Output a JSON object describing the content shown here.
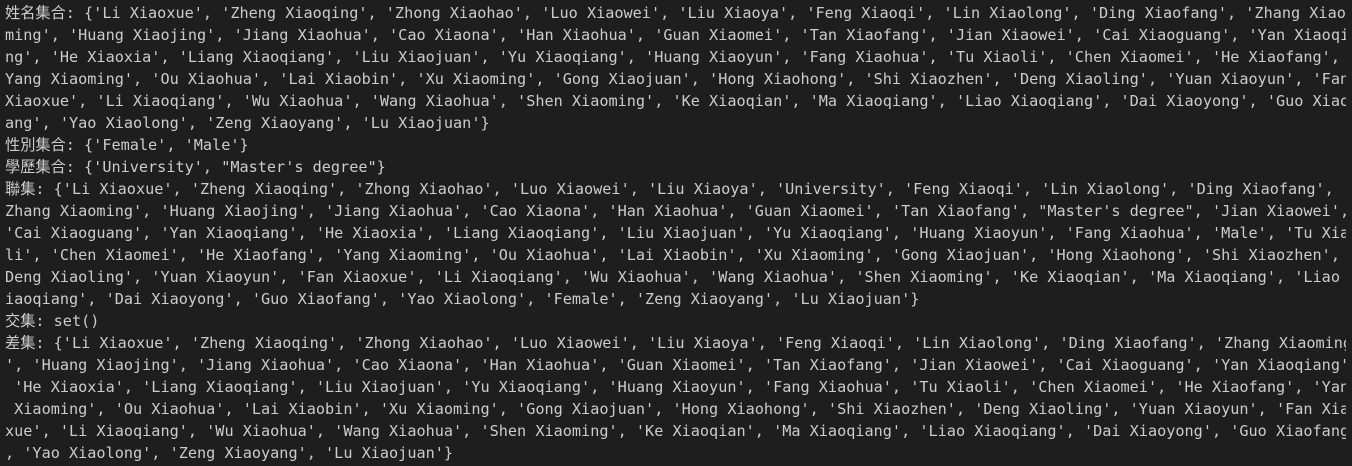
{
  "terminal": {
    "lines": [
      "姓名集合: {'Li Xiaoxue', 'Zheng Xiaoqing', 'Zhong Xiaohao', 'Luo Xiaowei', 'Liu Xiaoya', 'Feng Xiaoqi', 'Lin Xiaolong', 'Ding Xiaofang', 'Zhang Xiao",
      "ming', 'Huang Xiaojing', 'Jiang Xiaohua', 'Cao Xiaona', 'Han Xiaohua', 'Guan Xiaomei', 'Tan Xiaofang', 'Jian Xiaowei', 'Cai Xiaoguang', 'Yan Xiaoqia",
      "ng', 'He Xiaoxia', 'Liang Xiaoqiang', 'Liu Xiaojuan', 'Yu Xiaoqiang', 'Huang Xiaoyun', 'Fang Xiaohua', 'Tu Xiaoli', 'Chen Xiaomei', 'He Xiaofang', '",
      "Yang Xiaoming', 'Ou Xiaohua', 'Lai Xiaobin', 'Xu Xiaoming', 'Gong Xiaojuan', 'Hong Xiaohong', 'Shi Xiaozhen', 'Deng Xiaoling', 'Yuan Xiaoyun', 'Fan",
      "Xiaoxue', 'Li Xiaoqiang', 'Wu Xiaohua', 'Wang Xiaohua', 'Shen Xiaoming', 'Ke Xiaoqian', 'Ma Xiaoqiang', 'Liao Xiaoqiang', 'Dai Xiaoyong', 'Guo Xiaof",
      "ang', 'Yao Xiaolong', 'Zeng Xiaoyang', 'Lu Xiaojuan'}",
      "性別集合: {'Female', 'Male'}",
      "學歷集合: {'University', \"Master's degree\"}",
      "聯集: {'Li Xiaoxue', 'Zheng Xiaoqing', 'Zhong Xiaohao', 'Luo Xiaowei', 'Liu Xiaoya', 'University', 'Feng Xiaoqi', 'Lin Xiaolong', 'Ding Xiaofang', '",
      "Zhang Xiaoming', 'Huang Xiaojing', 'Jiang Xiaohua', 'Cao Xiaona', 'Han Xiaohua', 'Guan Xiaomei', 'Tan Xiaofang', \"Master's degree\", 'Jian Xiaowei',",
      "'Cai Xiaoguang', 'Yan Xiaoqiang', 'He Xiaoxia', 'Liang Xiaoqiang', 'Liu Xiaojuan', 'Yu Xiaoqiang', 'Huang Xiaoyun', 'Fang Xiaohua', 'Male', 'Tu Xiao",
      "li', 'Chen Xiaomei', 'He Xiaofang', 'Yang Xiaoming', 'Ou Xiaohua', 'Lai Xiaobin', 'Xu Xiaoming', 'Gong Xiaojuan', 'Hong Xiaohong', 'Shi Xiaozhen', '",
      "Deng Xiaoling', 'Yuan Xiaoyun', 'Fan Xiaoxue', 'Li Xiaoqiang', 'Wu Xiaohua', 'Wang Xiaohua', 'Shen Xiaoming', 'Ke Xiaoqian', 'Ma Xiaoqiang', 'Liao X",
      "iaoqiang', 'Dai Xiaoyong', 'Guo Xiaofang', 'Yao Xiaolong', 'Female', 'Zeng Xiaoyang', 'Lu Xiaojuan'}",
      "交集: set()",
      "差集: {'Li Xiaoxue', 'Zheng Xiaoqing', 'Zhong Xiaohao', 'Luo Xiaowei', 'Liu Xiaoya', 'Feng Xiaoqi', 'Lin Xiaolong', 'Ding Xiaofang', 'Zhang Xiaoming",
      "', 'Huang Xiaojing', 'Jiang Xiaohua', 'Cao Xiaona', 'Han Xiaohua', 'Guan Xiaomei', 'Tan Xiaofang', 'Jian Xiaowei', 'Cai Xiaoguang', 'Yan Xiaoqiang',",
      " 'He Xiaoxia', 'Liang Xiaoqiang', 'Liu Xiaojuan', 'Yu Xiaoqiang', 'Huang Xiaoyun', 'Fang Xiaohua', 'Tu Xiaoli', 'Chen Xiaomei', 'He Xiaofang', 'Yang",
      " Xiaoming', 'Ou Xiaohua', 'Lai Xiaobin', 'Xu Xiaoming', 'Gong Xiaojuan', 'Hong Xiaohong', 'Shi Xiaozhen', 'Deng Xiaoling', 'Yuan Xiaoyun', 'Fan Xiao",
      "xue', 'Li Xiaoqiang', 'Wu Xiaohua', 'Wang Xiaohua', 'Shen Xiaoming', 'Ke Xiaoqian', 'Ma Xiaoqiang', 'Liao Xiaoqiang', 'Dai Xiaoyong', 'Guo Xiaofang'",
      ", 'Yao Xiaolong', 'Zeng Xiaoyang', 'Lu Xiaojuan'}"
    ]
  }
}
